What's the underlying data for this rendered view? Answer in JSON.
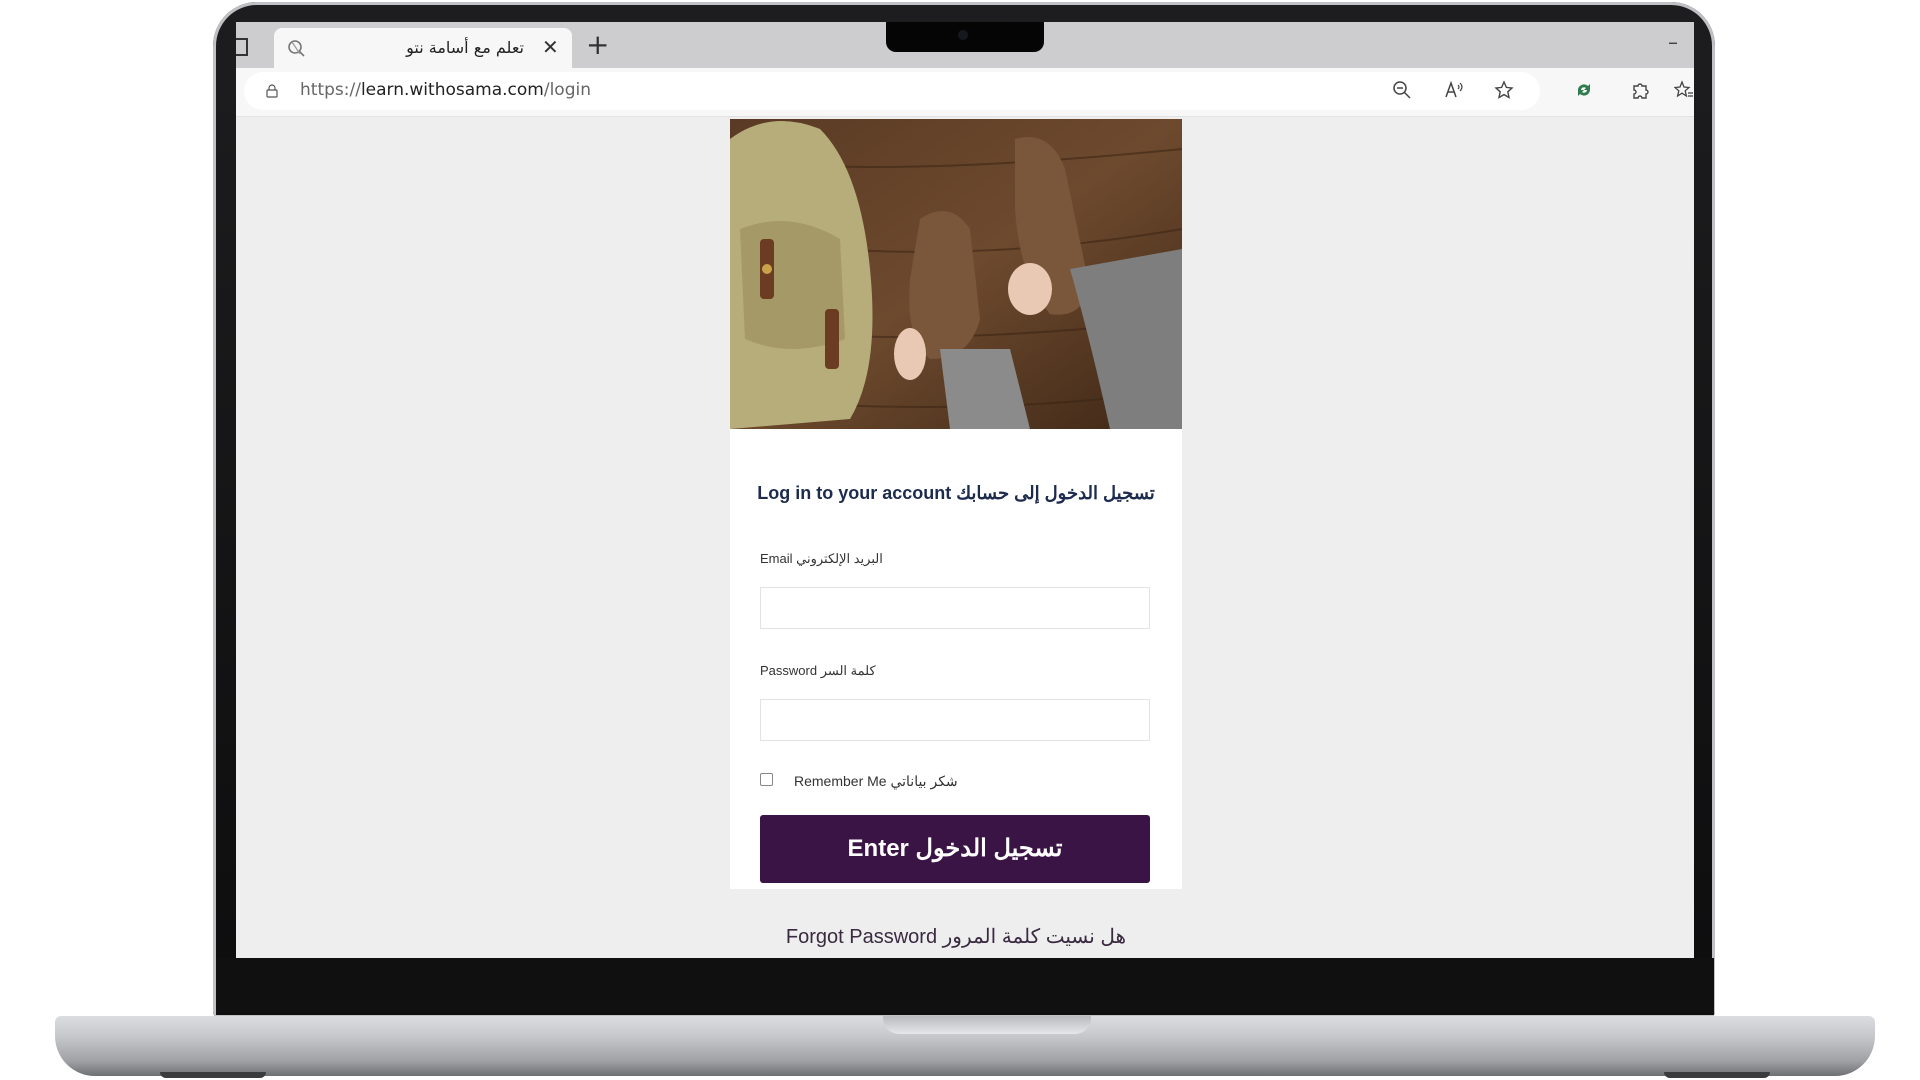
{
  "browser": {
    "tab_title": "تعلم مع أسامة نتو",
    "url_scheme": "https://",
    "url_host": "learn.withosama.com",
    "url_path": "/login",
    "icons": [
      "tab-actions-icon",
      "favicon",
      "close-icon",
      "new-tab-icon",
      "minimize-icon",
      "lock-icon",
      "zoom-out-icon",
      "read-aloud-icon",
      "favorite-star-icon",
      "extension-badge-icon",
      "extensions-puzzle-icon",
      "favorites-icon"
    ]
  },
  "login": {
    "heading": "Log in to your account تسجيل الدخول إلى حسابك",
    "email_label": "Email البريد الإلكتروني",
    "email_value": "",
    "password_label": "Password كلمة السر",
    "password_value": "",
    "remember_label": "Remember Me شكر بياناتي",
    "remember_checked": false,
    "enter_button": "Enter تسجيل الدخول",
    "forgot_link": "Forgot Password هل نسيت كلمة المرور"
  },
  "colors": {
    "button_bg": "#3b1446",
    "heading": "#1d2b4f",
    "page_bg": "#eeeeef"
  }
}
